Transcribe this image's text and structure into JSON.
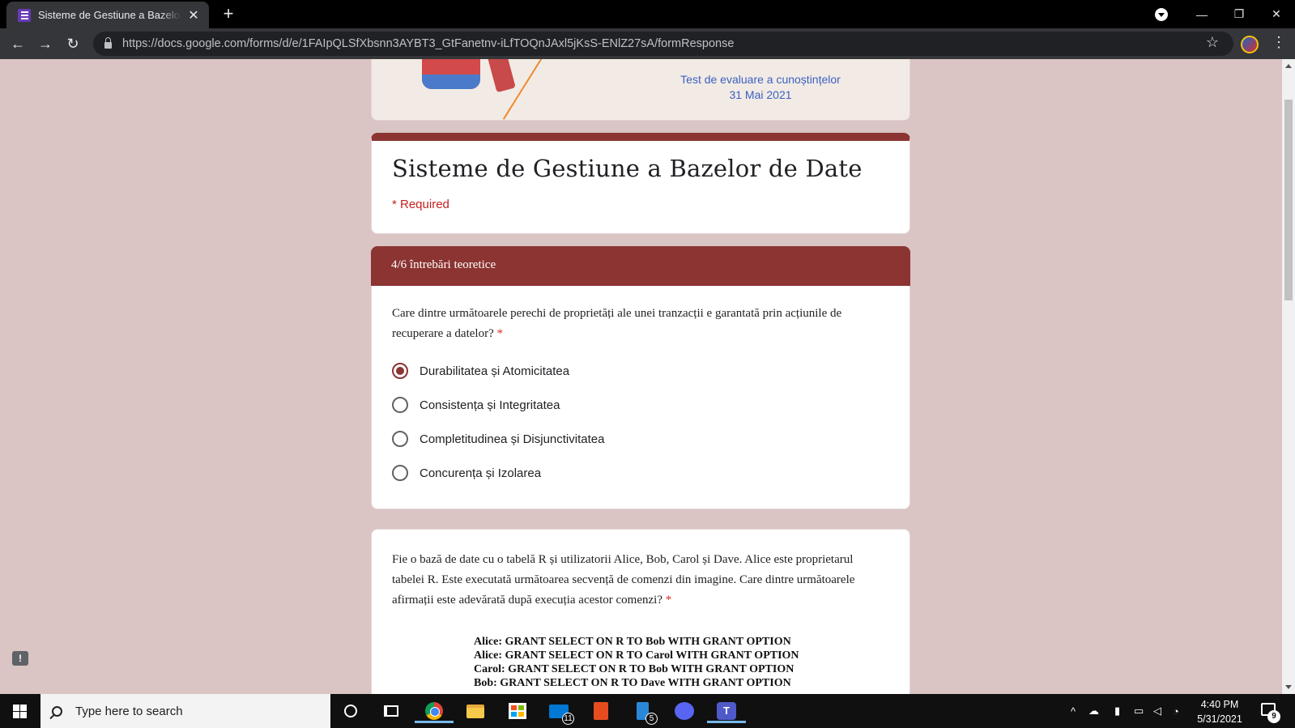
{
  "browser": {
    "tab_title": "Sisteme de Gestiune a Bazelor de Date",
    "tab_close": "✕",
    "new_tab": "+",
    "url": "https://docs.google.com/forms/d/e/1FAIpQLSfXbsnn3AYBT3_GtFanetnv-iLfTOQnJAxl5jKsS-ENlZ27sA/formResponse",
    "back": "←",
    "forward": "→",
    "reload": "↻",
    "star": "☆",
    "menu": "⋮",
    "minimize": "—",
    "restore": "❐",
    "close": "✕"
  },
  "banner": {
    "line1": "Test de evaluare a cunoștințelor",
    "line2": "31 Mai 2021"
  },
  "form": {
    "title": "Sisteme de Gestiune a Bazelor de Date",
    "required_note": "* Required",
    "section_title": "4/6 întrebări teoretice",
    "accent_color": "#8b3432"
  },
  "question1": {
    "text": "Care dintre următoarele perechi de proprietăți ale unei tranzacții e garantată prin acțiunile de recuperare a datelor?",
    "required_mark": " *",
    "options": [
      {
        "label": "Durabilitatea și Atomicitatea",
        "selected": true
      },
      {
        "label": "Consistența și Integritatea",
        "selected": false
      },
      {
        "label": "Completitudinea și Disjunctivitatea",
        "selected": false
      },
      {
        "label": "Concurența și Izolarea",
        "selected": false
      }
    ]
  },
  "question2": {
    "text": "Fie o bază de date cu o tabelă R și utilizatorii Alice, Bob, Carol și Dave. Alice este proprietarul tabelei R. Este executată următoarea secvență de comenzi din imagine. Care dintre următoarele afirmații este adevărată după execuția acestor comenzi?",
    "required_mark": " *",
    "image_lines": [
      "Alice: GRANT SELECT ON R TO Bob WITH GRANT OPTION",
      "Alice: GRANT SELECT ON R TO Carol WITH GRANT OPTION",
      "Carol: GRANT SELECT ON R TO Bob WITH GRANT OPTION",
      "Bob: GRANT SELECT ON R TO Dave WITH GRANT OPTION"
    ]
  },
  "taskbar": {
    "search_placeholder": "Type here to search",
    "mail_badge": "11",
    "phone_badge": "5",
    "time": "4:40 PM",
    "date": "5/31/2021",
    "notification_count": "9",
    "feedback_glyph": "!"
  }
}
